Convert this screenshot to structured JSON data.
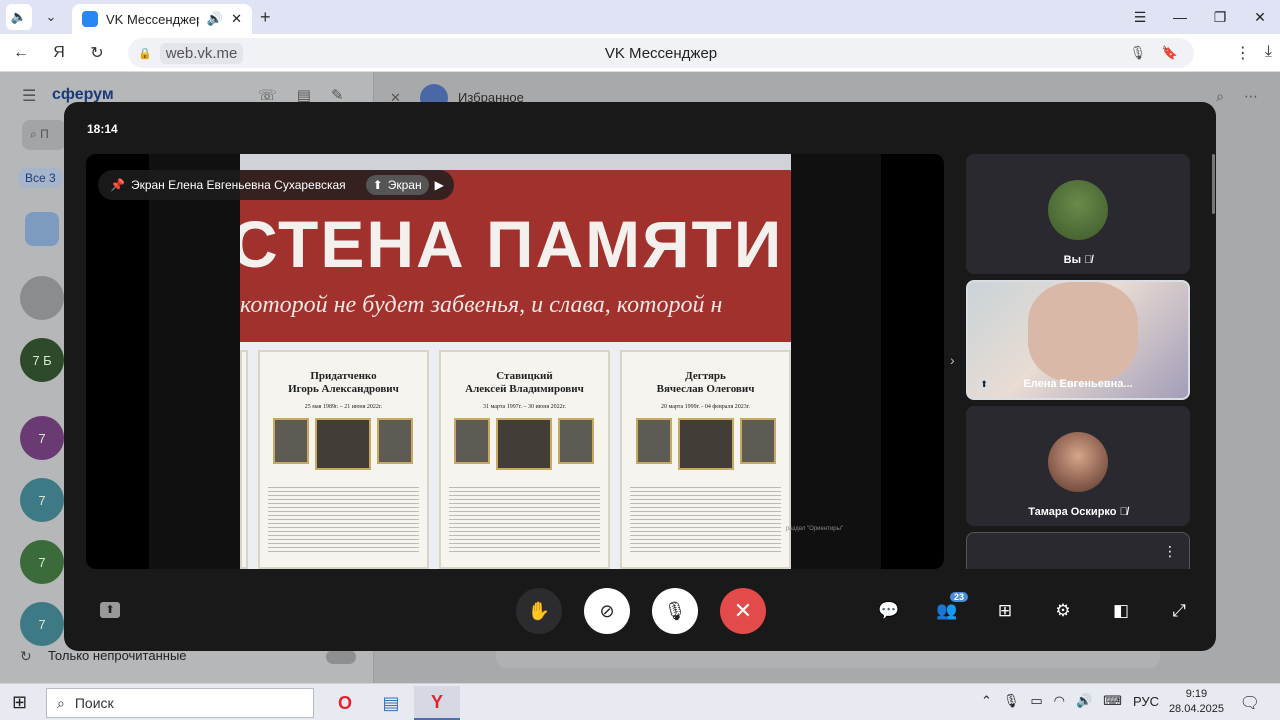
{
  "browser": {
    "tab_title": "VK Мессенджер",
    "url_host": "web.vk.me",
    "page_title": "VK Мессенджер",
    "icons": [
      "speaker-icon",
      "chevron-down-icon",
      "sound-icon",
      "close-icon",
      "plus-icon",
      "menu-icon",
      "restore-icon",
      "close-window-icon",
      "back-icon",
      "yandex-icon",
      "reload-icon",
      "lock-icon",
      "mic-icon",
      "bookmark-icon",
      "more-icon",
      "download-icon"
    ]
  },
  "vk": {
    "logo": "сферум",
    "search_placeholder": "П",
    "filter_all": "Все",
    "filter_count": "3",
    "chat_avatars": [
      "",
      "",
      "7 Б",
      "7",
      "7",
      "7",
      "7"
    ],
    "only_unread": "Только непрочитанные",
    "header_title": "Избранное"
  },
  "call": {
    "time": "18:14",
    "pin_label": "Экран Елена Евгеньевна Сухаревская",
    "screen_chip": "Экран",
    "shared": {
      "title": "СТЕНА ПАМЯТИ",
      "subtitle": "которой не будет забвенья, и слава, которой н",
      "boards": [
        {
          "surname": "Придатченко",
          "name": "Игорь Александрович",
          "dates": "25 мая 1989г. – 21 июня 2022г."
        },
        {
          "surname": "Ставицкий",
          "name": "Алексей Владимирович",
          "dates": "31 марта 1997г. – 30 июня 2022г."
        },
        {
          "surname": "Дегтярь",
          "name": "Вячеслав Олегович",
          "dates": "20 марта 1999г. - 04 февраля 2023г."
        }
      ],
      "footer_note": "раздел \"Ориентиры\""
    },
    "participants": [
      {
        "name": "Вы",
        "muted": true
      },
      {
        "name": "Елена Евгеньевна...",
        "muted": false
      },
      {
        "name": "Тамара Оскирко",
        "muted": true
      },
      {
        "name": "",
        "muted": false
      }
    ],
    "participants_badge": "23",
    "colors": {
      "end_call": "#e34a4a",
      "background": "#19191a",
      "accent": "#4a8cd8"
    }
  },
  "taskbar": {
    "search_label": "Поиск",
    "lang": "РУС",
    "time": "9:19",
    "date": "28.04.2025"
  }
}
